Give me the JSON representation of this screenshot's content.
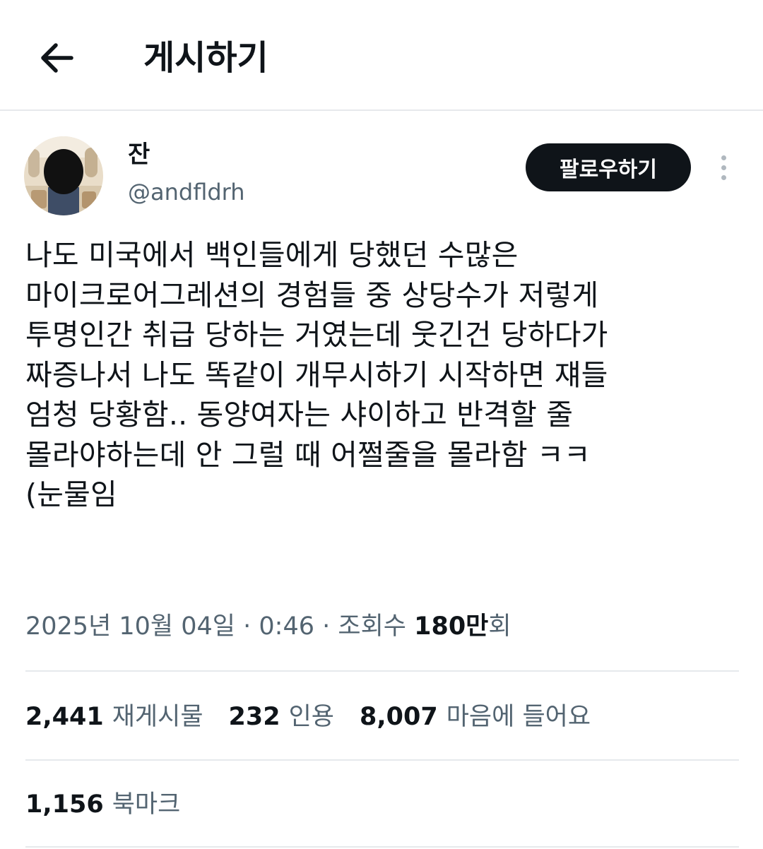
{
  "header": {
    "back_icon": "arrow-left-icon",
    "title": "게시하기"
  },
  "author": {
    "display_name": "잔",
    "handle": "@andfldrh",
    "follow_label": "팔로우하기",
    "more_icon": "more-vertical-icon"
  },
  "tweet": {
    "lines": [
      "나도 미국에서 백인들에게 당했던 수많은",
      "마이크로어그레션의 경험들 중 상당수가 저렇게",
      "투명인간 취급 당하는 거였는데 웃긴건 당하다가",
      "짜증나서 나도 똑같이 개무시하기 시작하면 쟤들",
      "엄청 당황함.. 동양여자는 샤이하고 반격할 줄",
      "몰라야하는데 안 그럴 때 어쩔줄을 몰라함 ㅋㅋ",
      "(눈물임"
    ]
  },
  "meta": {
    "date": "2025년 10월 04일",
    "sep1": " · ",
    "time": "0:46",
    "sep2": " · ",
    "views_label": "조회수 ",
    "views_number": "180만",
    "views_suffix": "회"
  },
  "stats": {
    "reposts_count": "2,441",
    "reposts_label": "재게시물",
    "quotes_count": "232",
    "quotes_label": "인용",
    "likes_count": "8,007",
    "likes_label": "마음에 들어요",
    "bookmarks_count": "1,156",
    "bookmarks_label": "북마크"
  },
  "colors": {
    "text_primary": "#0f1419",
    "text_secondary": "#536471",
    "divider": "#e6e9ec",
    "follow_bg": "#0f1419"
  }
}
